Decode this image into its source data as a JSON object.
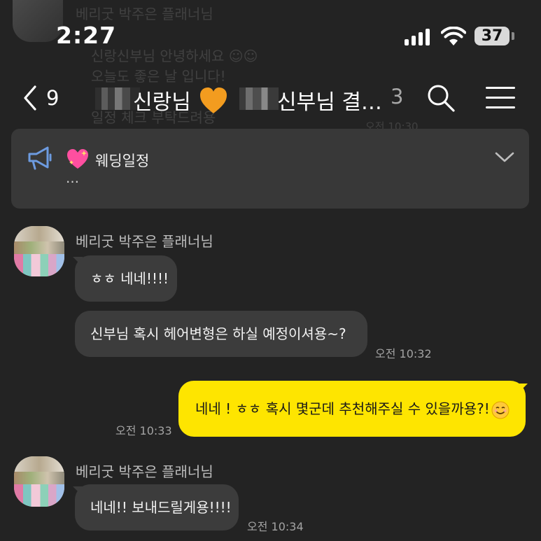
{
  "status_bar": {
    "time": "2:27",
    "battery": "37"
  },
  "header": {
    "back_count": "9",
    "title_part1": "신랑님",
    "title_part2": "신부님 결…",
    "member_count": "3"
  },
  "background_chat": {
    "sender": "베리굿 박주은 플래너님",
    "line1": "신랑신부님 안녕하세요 ☺☺",
    "line2": "오늘도 좋은 날 입니다!",
    "line3": "일정 체크 부탁드려용",
    "time": "오전 10:30"
  },
  "notice": {
    "title": "웨딩일정",
    "preview": "…"
  },
  "messages": [
    {
      "sender": "베리굿 박주은 플래너님",
      "text": "ㅎㅎ 네네!!!!"
    },
    {
      "text": "신부님 혹시 헤어변형은 하실 예정이셔용~?",
      "time": "오전 10:32"
    },
    {
      "text": "네네 ! ㅎㅎ 혹시 몇군데 추천해주실 수 있을까용?!",
      "time": "오전 10:33"
    },
    {
      "sender": "베리굿 박주은 플래너님",
      "text": "네네!! 보내드릴게용!!!!",
      "time": "오전 10:34"
    }
  ],
  "colors": {
    "background": "#232323",
    "bubble_other": "#3c3c3c",
    "bubble_mine": "#fee500",
    "notice": "#383838"
  }
}
